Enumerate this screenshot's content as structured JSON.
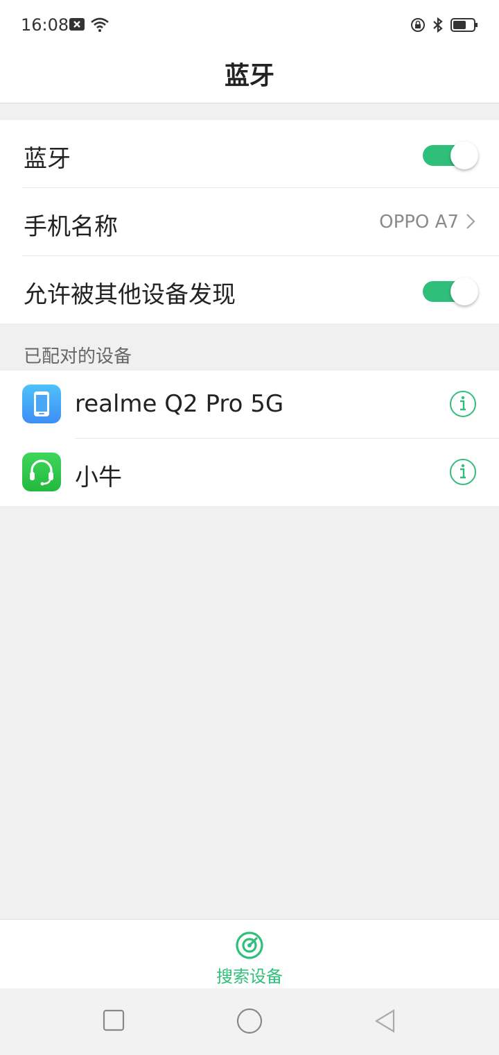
{
  "status_bar": {
    "time": "16:08",
    "icons": [
      "notification-x-icon",
      "wifi-icon",
      "rotation-lock-icon",
      "bluetooth-icon",
      "battery-icon"
    ]
  },
  "header": {
    "title": "蓝牙"
  },
  "settings": {
    "bluetooth": {
      "label": "蓝牙",
      "enabled": true
    },
    "phone_name": {
      "label": "手机名称",
      "value": "OPPO A7"
    },
    "discoverable": {
      "label": "允许被其他设备发现",
      "enabled": true
    }
  },
  "paired": {
    "header": "已配对的设备",
    "devices": [
      {
        "name": "realme Q2 Pro 5G",
        "icon": "phone-icon"
      },
      {
        "name": "小牛",
        "icon": "headset-icon"
      }
    ]
  },
  "bottom_action": {
    "label": "搜索设备",
    "icon": "radar-search-icon"
  },
  "nav": [
    "recents-button",
    "home-button",
    "back-button"
  ],
  "colors": {
    "accent": "#2fbf7a",
    "phone_icon_bg": "#3d9cf5",
    "headset_icon_bg": "#2dc84d"
  }
}
